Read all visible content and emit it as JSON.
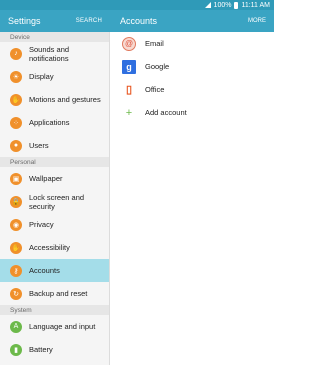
{
  "status_bar": {
    "battery": "100%",
    "time": "11:11 AM"
  },
  "appbar": {
    "settings_title": "Settings",
    "search_label": "SEARCH",
    "accounts_title": "Accounts",
    "more_label": "MORE"
  },
  "sidebar": {
    "sections": [
      {
        "label": "Device"
      },
      {
        "label": "Personal"
      },
      {
        "label": "System"
      }
    ],
    "items": [
      {
        "label": "Sounds and notifications",
        "icon": "volume-icon"
      },
      {
        "label": "Display",
        "icon": "display-icon"
      },
      {
        "label": "Motions and gestures",
        "icon": "motion-icon"
      },
      {
        "label": "Applications",
        "icon": "apps-icon"
      },
      {
        "label": "Users",
        "icon": "user-icon"
      },
      {
        "label": "Wallpaper",
        "icon": "wallpaper-icon"
      },
      {
        "label": "Lock screen and security",
        "icon": "lock-icon"
      },
      {
        "label": "Privacy",
        "icon": "privacy-icon"
      },
      {
        "label": "Accessibility",
        "icon": "accessibility-icon"
      },
      {
        "label": "Accounts",
        "icon": "key-icon",
        "selected": true
      },
      {
        "label": "Backup and reset",
        "icon": "backup-icon"
      },
      {
        "label": "Language and input",
        "icon": "language-icon"
      },
      {
        "label": "Battery",
        "icon": "battery-icon"
      }
    ]
  },
  "accounts": {
    "items": [
      {
        "label": "Email",
        "icon": "email-icon"
      },
      {
        "label": "Google",
        "icon": "google-icon"
      },
      {
        "label": "Office",
        "icon": "office-icon"
      },
      {
        "label": "Add account",
        "icon": "plus-icon"
      }
    ]
  },
  "colors": {
    "appbar": "#3aa4c3",
    "status_bar": "#2f9ab8",
    "selected": "#a4dde9",
    "icon_orange": "#f0902b",
    "icon_green": "#6cb94a"
  }
}
